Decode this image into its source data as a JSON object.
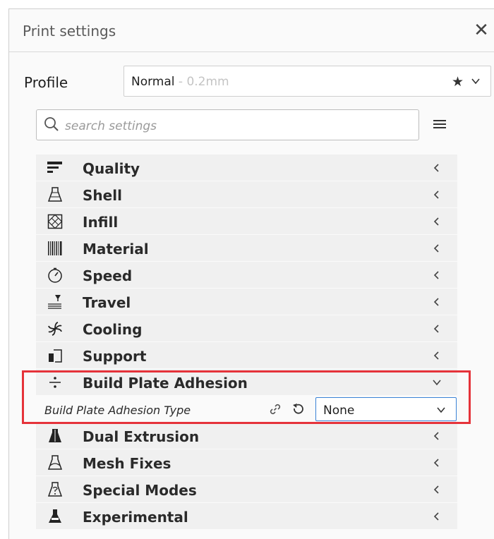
{
  "window": {
    "title": "Print settings",
    "close_symbol": "✕"
  },
  "profile": {
    "label": "Profile",
    "name": "Normal",
    "layer_height": " - 0.2mm",
    "favorite_symbol": "★"
  },
  "search": {
    "placeholder": "search settings"
  },
  "categories": [
    {
      "label": "Quality",
      "icon": "quality-icon"
    },
    {
      "label": "Shell",
      "icon": "shell-icon"
    },
    {
      "label": "Infill",
      "icon": "infill-icon"
    },
    {
      "label": "Material",
      "icon": "material-icon"
    },
    {
      "label": "Speed",
      "icon": "speed-icon"
    },
    {
      "label": "Travel",
      "icon": "travel-icon"
    },
    {
      "label": "Cooling",
      "icon": "cooling-icon"
    },
    {
      "label": "Support",
      "icon": "support-icon"
    },
    {
      "label": "Build Plate Adhesion",
      "icon": "build-plate-adhesion-icon",
      "expanded": true
    },
    {
      "label": "Dual Extrusion",
      "icon": "dual-extrusion-icon"
    },
    {
      "label": "Mesh Fixes",
      "icon": "mesh-fixes-icon"
    },
    {
      "label": "Special Modes",
      "icon": "special-modes-icon"
    },
    {
      "label": "Experimental",
      "icon": "experimental-icon"
    }
  ],
  "adhesion_setting": {
    "label": "Build Plate Adhesion Type",
    "value": "None"
  },
  "colors": {
    "highlight": "#e5333a",
    "select_border": "#3a82d6",
    "row_background": "#f0f0f0"
  }
}
